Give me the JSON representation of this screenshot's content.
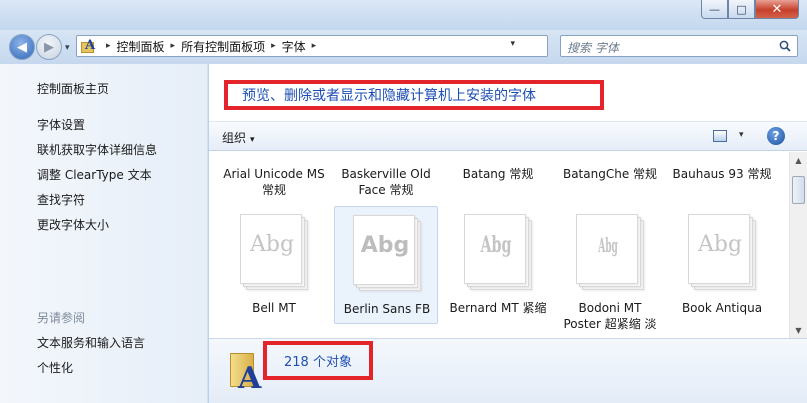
{
  "window": {
    "minimize_label": "—",
    "maximize_label": "□",
    "close_label": "✕"
  },
  "nav": {
    "back_icon": "back-arrow-icon",
    "forward_icon": "forward-arrow-icon",
    "back_glyph": "◀",
    "forward_glyph": "▶",
    "recent_glyph": "▾"
  },
  "address": {
    "crumbs": [
      "控制面板",
      "所有控制面板项",
      "字体"
    ],
    "separator": "▸",
    "dropdown_glyph": "▾",
    "refresh_glyph": "⟳"
  },
  "search": {
    "placeholder": "搜索 字体"
  },
  "sidebar": {
    "home": "控制面板主页",
    "links": [
      "字体设置",
      "联机获取字体详细信息",
      "调整 ClearType 文本",
      "查找字符",
      "更改字体大小"
    ],
    "see_also_label": "另请参阅",
    "see_also": [
      "文本服务和输入语言",
      "个性化"
    ]
  },
  "main": {
    "heading": "预览、删除或者显示和隐藏计算机上安装的字体",
    "toolbar": {
      "organize": "组织",
      "organize_arrow": "▾",
      "view_dd": "▾",
      "help": "?"
    },
    "row1": [
      {
        "name": "Arial Unicode MS 常规"
      },
      {
        "name": "Baskerville Old Face 常规"
      },
      {
        "name": "Batang 常规"
      },
      {
        "name": "BatangChe 常规"
      },
      {
        "name": "Bauhaus 93 常规"
      }
    ],
    "row2": [
      {
        "name": "Bell MT",
        "sample": "Abg"
      },
      {
        "name": "Berlin Sans FB",
        "sample": "Abg"
      },
      {
        "name": "Bernard MT 紧缩",
        "sample": "Abg"
      },
      {
        "name": "Bodoni MT Poster 超紧缩 淡",
        "sample": "Abg"
      },
      {
        "name": "Book Antiqua",
        "sample": "Abg"
      }
    ],
    "scroll_up": "▲",
    "scroll_down": "▼"
  },
  "details": {
    "count": "218 个对象"
  },
  "colors": {
    "highlight_border": "#e3242b",
    "link_blue": "#1e4fb4"
  }
}
